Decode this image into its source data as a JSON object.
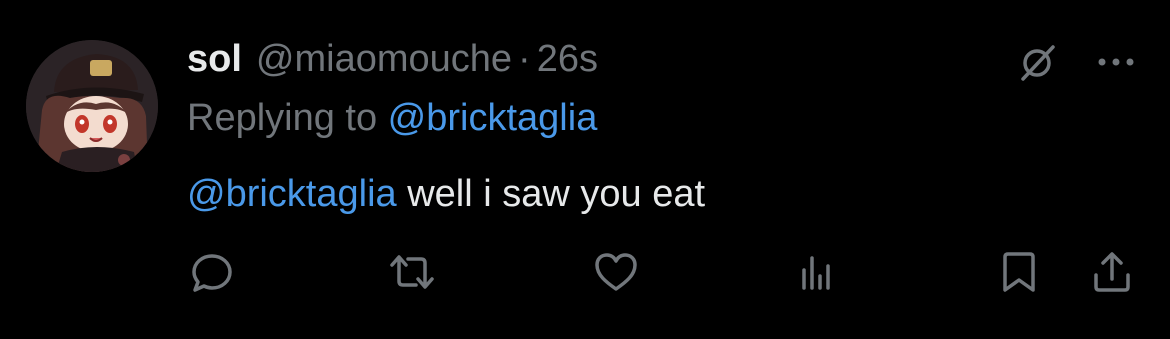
{
  "tweet": {
    "author": {
      "display_name": "sol",
      "handle": "@miaomouche",
      "avatar_icon": "avatar-anime-character-icon"
    },
    "separator": "·",
    "time": "26s",
    "replying_to": {
      "prefix": "Replying to ",
      "mention": "@bricktaglia"
    },
    "text": {
      "mention": "@bricktaglia",
      "body": " well i saw you eat"
    }
  },
  "icons": {
    "top_right": [
      "grok-icon",
      "more-icon"
    ],
    "actions": [
      "reply-icon",
      "retweet-icon",
      "like-icon",
      "views-icon",
      "bookmark-icon",
      "share-icon"
    ]
  },
  "colors": {
    "background": "#000000",
    "primary_text": "#e7e9ea",
    "secondary_text": "#71767b",
    "link": "#4a99e9"
  }
}
